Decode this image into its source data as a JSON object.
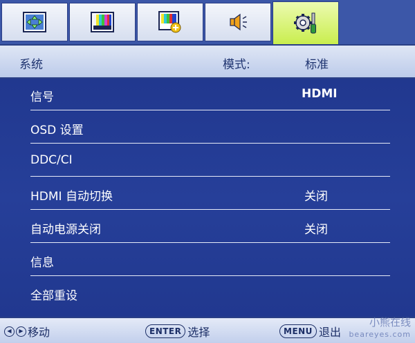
{
  "tabs": [
    {
      "icon": "display-arrows-icon"
    },
    {
      "icon": "color-bars-icon"
    },
    {
      "icon": "picture-add-icon"
    },
    {
      "icon": "speaker-icon"
    },
    {
      "icon": "gear-screwdriver-icon",
      "active": true
    }
  ],
  "header": {
    "section": "系统",
    "mode_label": "模式:",
    "mode_value": "标准"
  },
  "menu": {
    "items": [
      {
        "label": "信号",
        "value": "HDMI"
      },
      {
        "label": "OSD 设置",
        "value": ""
      },
      {
        "label": "DDC/CI",
        "value": ""
      },
      {
        "label": "HDMI 自动切换",
        "value": "关闭"
      },
      {
        "label": "自动电源关闭",
        "value": "关闭"
      },
      {
        "label": "信息",
        "value": ""
      },
      {
        "label": "全部重设",
        "value": ""
      }
    ]
  },
  "footer": {
    "move_label": "移动",
    "enter_key": "ENTER",
    "select_label": "选择",
    "menu_key": "MENU",
    "exit_label": "退出"
  },
  "watermark": {
    "line1": "小熊在线",
    "line2": "beareyes.com"
  },
  "colors": {
    "menu_background": "#213a93",
    "active_tab": "#c9ee4e",
    "header_text": "#1f3470"
  }
}
